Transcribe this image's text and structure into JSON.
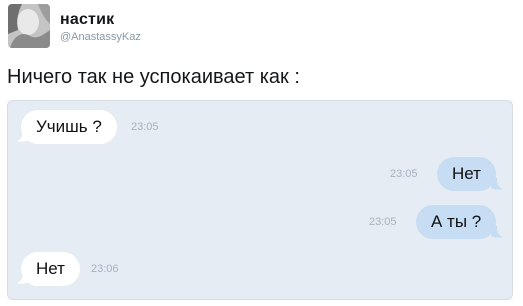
{
  "author": {
    "display_name": "настик",
    "handle": "@AnastassyKaz",
    "avatar": "avatar-photo"
  },
  "tweet": {
    "text": "Ничего так не успокаивает как :"
  },
  "chat": {
    "messages": [
      {
        "direction": "incoming",
        "text": "Учишь ?",
        "time": "23:05"
      },
      {
        "direction": "outgoing",
        "text": "Нет",
        "time": "23:05"
      },
      {
        "direction": "outgoing",
        "text": "А ты ?",
        "time": "23:05"
      },
      {
        "direction": "incoming",
        "text": "Нет",
        "time": "23:06"
      }
    ],
    "colors": {
      "background": "#e6ecf4",
      "incoming_bubble": "#ffffff",
      "outgoing_bubble": "#c7ddf4",
      "timestamp": "#a7b2bd"
    }
  }
}
